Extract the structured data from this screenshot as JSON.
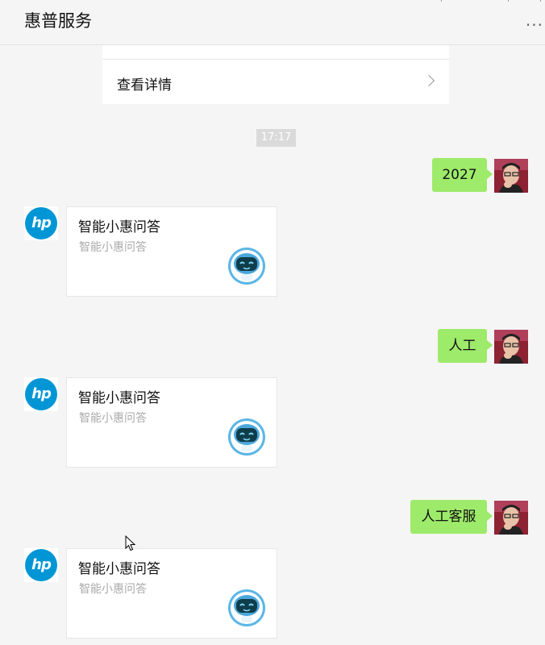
{
  "header": {
    "title": "惠普服务",
    "more_label": "···"
  },
  "detail_card": {
    "label": "查看详情"
  },
  "timestamp": "17:17",
  "conversation": [
    {
      "user_message": "2027",
      "bot_title": "智能小惠问答",
      "bot_subtitle": "智能小惠问答"
    },
    {
      "user_message": "人工",
      "bot_title": "智能小惠问答",
      "bot_subtitle": "智能小惠问答"
    },
    {
      "user_message": "人工客服",
      "bot_title": "智能小惠问答",
      "bot_subtitle": "智能小惠问答"
    }
  ],
  "icons": {
    "bot_avatar": "hp-logo-icon",
    "user_avatar": "user-photo-avatar",
    "card_image": "robot-icon",
    "detail_arrow": "chevron-right-icon"
  },
  "colors": {
    "background": "#f5f5f5",
    "user_bubble": "#9eea6a",
    "hp_blue": "#0096d6",
    "subtitle_gray": "#aaaaaa"
  },
  "hp_logo_text": "hp"
}
